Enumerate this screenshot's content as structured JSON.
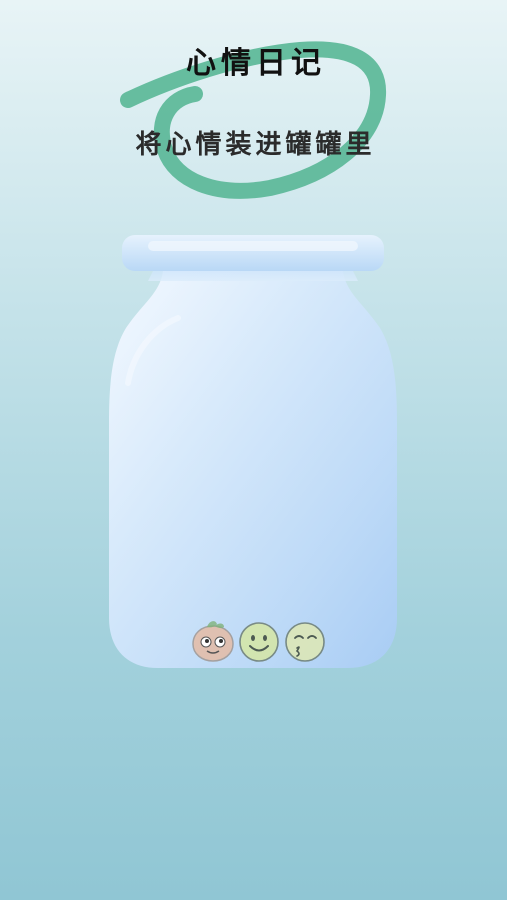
{
  "header": {
    "title": "心情日记",
    "subtitle": "将心情装进罐罐里"
  },
  "colors": {
    "accent_scribble": "#5fb99a",
    "jar_body": "#b8d8f7",
    "jar_lid": "#c6e0f8",
    "title_text": "#111111",
    "subtitle_text": "#2b2b2b"
  },
  "jar": {
    "moods": [
      {
        "icon": "orange-face-icon"
      },
      {
        "icon": "smiley-face-icon"
      },
      {
        "icon": "kissing-face-icon"
      }
    ]
  }
}
